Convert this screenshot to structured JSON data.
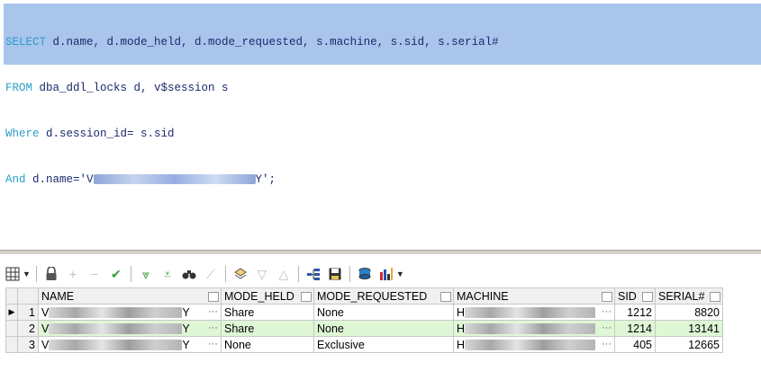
{
  "editor": {
    "lines": [
      {
        "kw": "SELECT",
        "text": " d.name, d.mode_held, d.mode_requested, s.machine, s.sid, s.serial#"
      },
      {
        "kw": "FROM",
        "text": " dba_ddl_locks d, v$session s"
      },
      {
        "kw": "Where",
        "text": " d.session_id= s.sid"
      },
      {
        "kw": "And",
        "text_prefix": " d.name='V",
        "text_suffix": "Y';"
      }
    ]
  },
  "toolbar": {
    "icons": [
      "grid-view-icon",
      "lock-icon",
      "add-record-icon",
      "delete-record-icon",
      "post-changes-icon",
      "fetch-next-icon",
      "fetch-last-icon",
      "query-by-example-icon",
      "clear-icon",
      "single-record-view-icon",
      "previous-icon",
      "next-icon",
      "explain-plan-icon",
      "save-icon",
      "export-icon",
      "chart-icon"
    ]
  },
  "grid": {
    "columns": [
      "NAME",
      "MODE_HELD",
      "MODE_REQUESTED",
      "MACHINE",
      "SID",
      "SERIAL#"
    ],
    "rows": [
      {
        "num": "1",
        "name_prefix": "V",
        "name_suffix": "Y",
        "mode_held": "Share",
        "mode_requested": "None",
        "machine_prefix": "H",
        "sid": "1212",
        "serial": "8820"
      },
      {
        "num": "2",
        "name_prefix": "V",
        "name_suffix": "Y",
        "mode_held": "Share",
        "mode_requested": "None",
        "machine_prefix": "H",
        "sid": "1214",
        "serial": "13141"
      },
      {
        "num": "3",
        "name_prefix": "V",
        "name_suffix": "Y",
        "mode_held": "None",
        "mode_requested": "Exclusive",
        "machine_prefix": "H",
        "sid": "405",
        "serial": "12665"
      }
    ]
  },
  "colors": {
    "selection": "#a9c5ec",
    "keyword": "#2c9cc8",
    "highlight_row": "#dff7d5"
  }
}
